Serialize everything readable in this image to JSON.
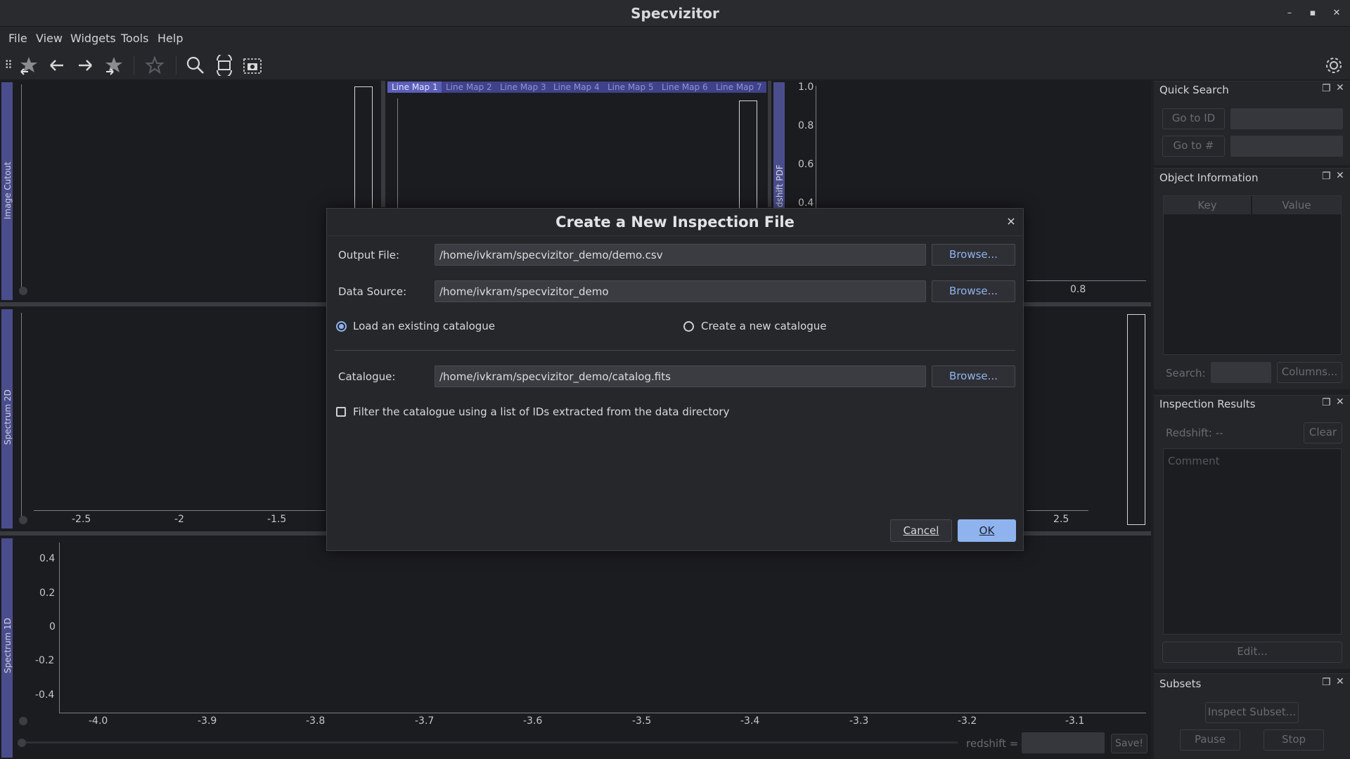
{
  "window": {
    "title": "Specvizitor",
    "minimize": "–",
    "maximize": "▪",
    "close": "✕"
  },
  "menu": {
    "file": "File",
    "view": "View",
    "widgets": "Widgets",
    "tools": "Tools",
    "help": "Help"
  },
  "toolbar": {
    "icons": [
      "grip-icon",
      "star-back-icon",
      "arrow-left-icon",
      "arrow-right-icon",
      "star-forward-icon",
      "star-icon",
      "zoom-icon",
      "reset-view-icon",
      "screenshot-icon",
      "gear-icon"
    ]
  },
  "image_cutout": {
    "label": "Image Cutout"
  },
  "line_maps": {
    "tabs": [
      "Line Map 1",
      "Line Map 2",
      "Line Map 3",
      "Line Map 4",
      "Line Map 5",
      "Line Map 6",
      "Line Map 7"
    ]
  },
  "redshift_pdf": {
    "label": "dshift PDF",
    "y_ticks": [
      "1.0",
      "0.8",
      "0.6",
      "0.4"
    ],
    "x_ticks": [
      "0.8"
    ]
  },
  "spectrum_2d": {
    "label": "Spectrum 2D",
    "x_ticks": [
      "-2.5",
      "-2",
      "-1.5",
      "2.5"
    ]
  },
  "spectrum_1d": {
    "label": "Spectrum 1D",
    "y_ticks": [
      "0.4",
      "0.2",
      "0",
      "-0.2",
      "-0.4"
    ],
    "x_ticks": [
      "-4.0",
      "-3.9",
      "-3.8",
      "-3.7",
      "-3.6",
      "-3.5",
      "-3.4",
      "-3.3",
      "-3.2",
      "-3.1"
    ],
    "redshift_label": "redshift =",
    "save_label": "Save!"
  },
  "quick_search": {
    "title": "Quick Search",
    "go_to_id": "Go to ID",
    "go_to_num": "Go to #"
  },
  "object_info": {
    "title": "Object Information",
    "col_key": "Key",
    "col_value": "Value",
    "search_label": "Search:",
    "columns_button": "Columns..."
  },
  "inspection_results": {
    "title": "Inspection Results",
    "redshift": "Redshift: --",
    "clear": "Clear",
    "comment_placeholder": "Comment",
    "edit": "Edit..."
  },
  "subsets": {
    "title": "Subsets",
    "inspect": "Inspect Subset...",
    "pause": "Pause",
    "stop": "Stop"
  },
  "dialog": {
    "title": "Create a New Inspection File",
    "close": "×",
    "output_file_label": "Output File:",
    "output_file_value": "/home/ivkram/specvizitor_demo/demo.csv",
    "data_source_label": "Data Source:",
    "data_source_value": "/home/ivkram/specvizitor_demo",
    "browse": "Browse...",
    "load_existing": "Load an existing catalogue",
    "create_new": "Create a new catalogue",
    "catalogue_label": "Catalogue:",
    "catalogue_value": "/home/ivkram/specvizitor_demo/catalog.fits",
    "filter_label": "Filter the catalogue using a list of IDs extracted from the data directory",
    "cancel": "Cancel",
    "ok": "OK"
  },
  "colors": {
    "accent": "#8fb3ee",
    "panel_label": "#4a4d8c",
    "background": "#1e1f23"
  }
}
